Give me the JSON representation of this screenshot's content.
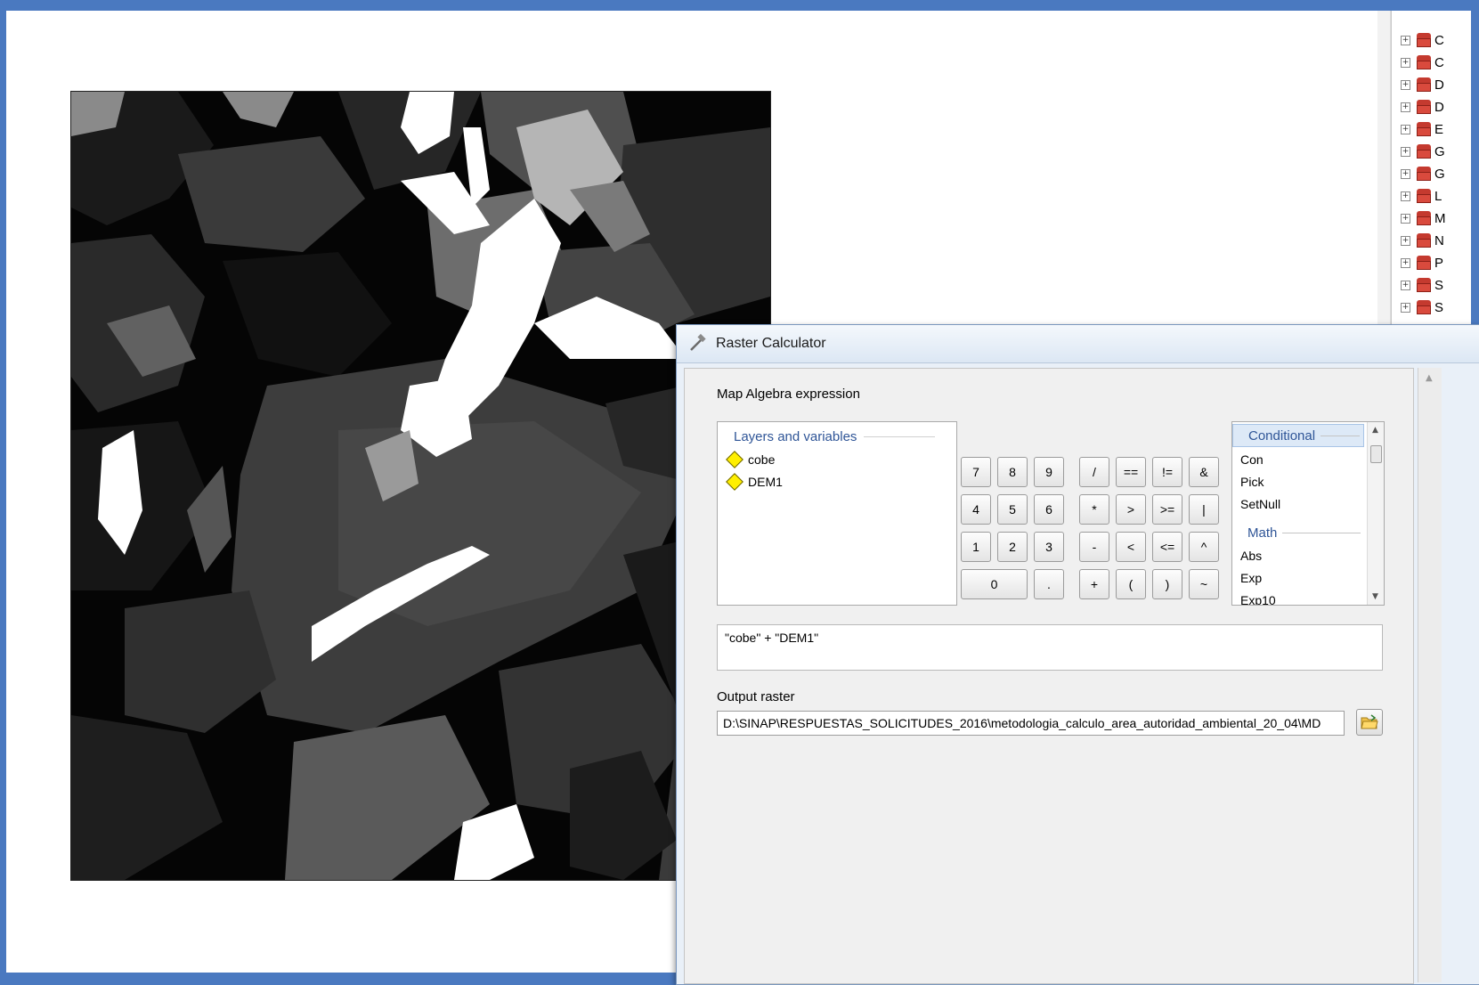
{
  "dialog": {
    "title": "Raster Calculator",
    "expression_label": "Map Algebra expression",
    "layers_header": "Layers and variables",
    "layers": [
      "cobe",
      "DEM1"
    ],
    "calc_buttons": {
      "row1": [
        "7",
        "8",
        "9",
        "/",
        "==",
        "!=",
        "&"
      ],
      "row2": [
        "4",
        "5",
        "6",
        "*",
        ">",
        ">=",
        "|"
      ],
      "row3": [
        "1",
        "2",
        "3",
        "-",
        "<",
        "<=",
        "^"
      ],
      "row4": [
        "0",
        ".",
        "+",
        "(",
        ")",
        "~"
      ]
    },
    "functions": {
      "conditional_header": "Conditional",
      "conditional_items": [
        "Con",
        "Pick",
        "SetNull"
      ],
      "math_header": "Math",
      "math_items": [
        "Abs",
        "Exp",
        "Exp10"
      ]
    },
    "expression_value": "\"cobe\" + \"DEM1\"",
    "output_label": "Output raster",
    "output_value": "D:\\SINAP\\RESPUESTAS_SOLICITUDES_2016\\metodologia_calculo_area_autoridad_ambiental_20_04\\MD"
  },
  "toc": {
    "items": [
      "C",
      "C",
      "D",
      "D",
      "E",
      "G",
      "G",
      "L",
      "M",
      "N",
      "P",
      "S",
      "S"
    ]
  },
  "colors": {
    "frame": "#4a79c0",
    "group_header": "#2f5597",
    "layer_diamond": "#ffef00"
  }
}
